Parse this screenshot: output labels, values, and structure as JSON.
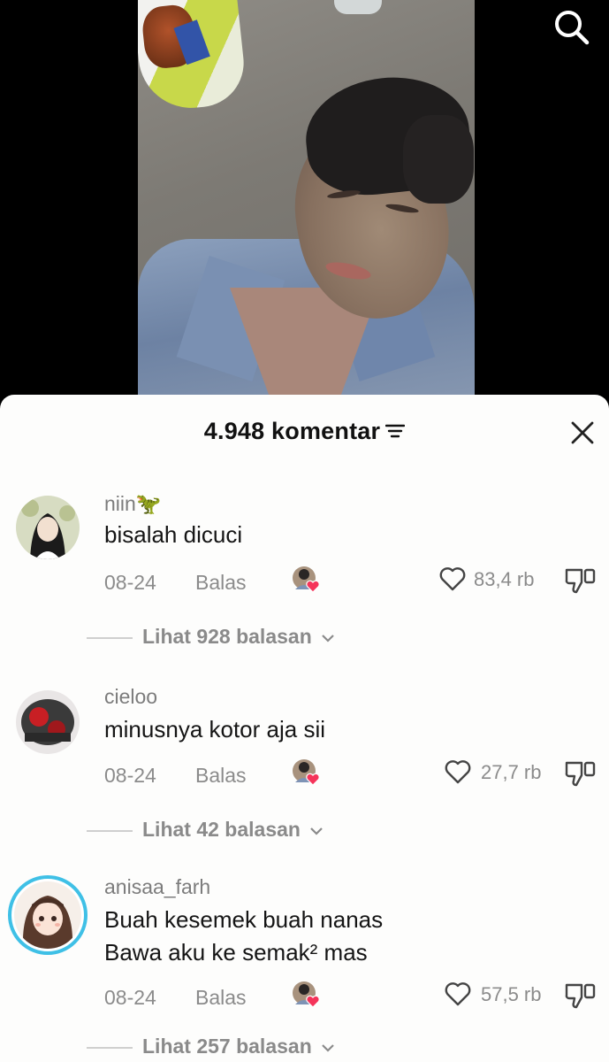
{
  "header": {
    "comment_count_label": "4.948 komentar"
  },
  "icons": {
    "search": "search-icon",
    "sort": "sort-lines-icon",
    "close": "close-icon",
    "like": "heart-outline-icon",
    "dislike": "thumbs-down-icon",
    "creator_liked": "creator-avatar-heart-icon",
    "chevron": "chevron-down-icon"
  },
  "colors": {
    "creator_heart": "#f5345a",
    "avatar_ring": "#3fc0e6",
    "sheet_bg": "#fdfdfc"
  },
  "comments": [
    {
      "username": "niin🦖",
      "text": "bisalah dicuci",
      "date": "08-24",
      "reply_label": "Balas",
      "likes": "83,4 rb",
      "view_replies": "Lihat 928 balasan"
    },
    {
      "username": "cieloo",
      "text": "minusnya kotor aja sii",
      "date": "08-24",
      "reply_label": "Balas",
      "likes": "27,7 rb",
      "view_replies": "Lihat 42 balasan"
    },
    {
      "username": "anisaa_farh",
      "text": "Buah kesemek buah nanas\nBawa aku ke semak² mas",
      "date": "08-24",
      "reply_label": "Balas",
      "likes": "57,5 rb",
      "view_replies": "Lihat 257 balasan"
    }
  ]
}
